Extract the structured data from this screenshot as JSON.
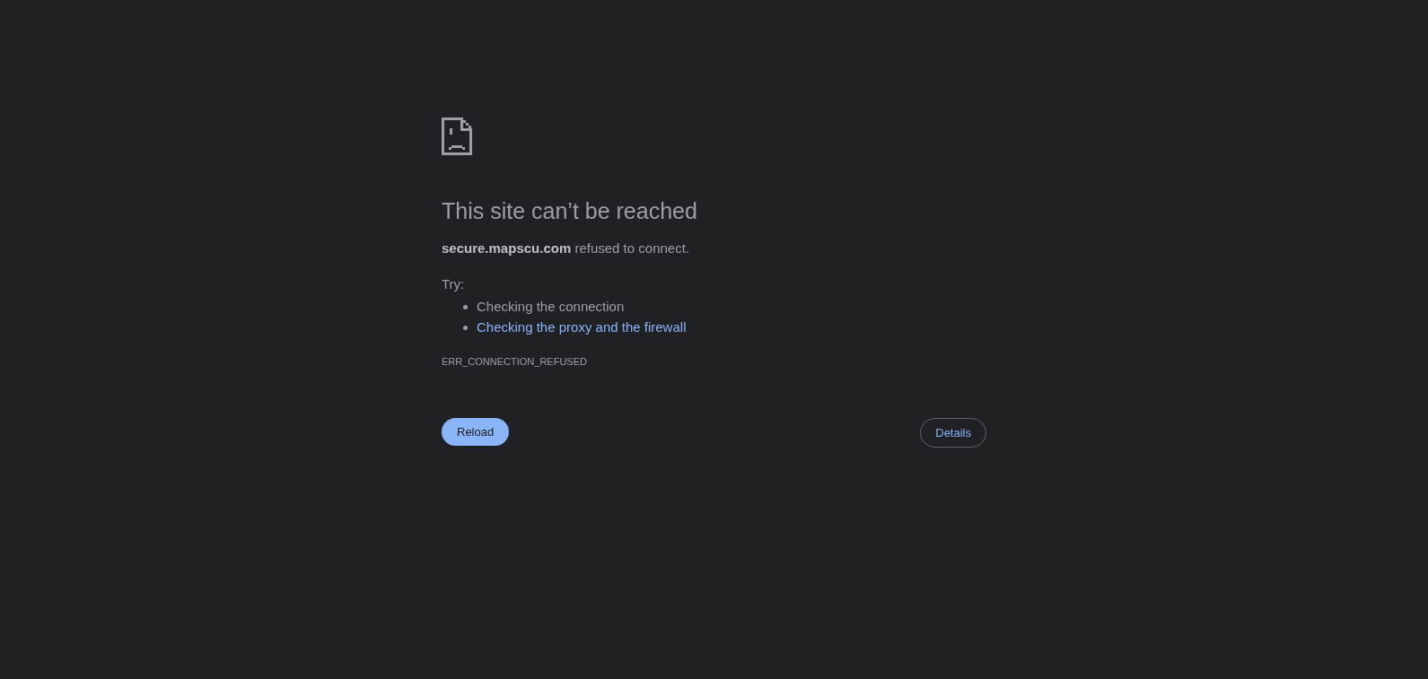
{
  "heading": "This site can’t be reached",
  "message": "**secure.mapscu.com** refused to connect.",
  "suggestions": {
    "label": "Try:",
    "items": [
      {
        "text": "Checking the connection",
        "kind": "text"
      },
      {
        "text": "Checking the proxy and the firewall",
        "kind": "link"
      }
    ]
  },
  "error_code": "ERR_CONNECTION_REFUSED",
  "buttons": [
    {
      "label": "Reload",
      "kind": "primary"
    },
    {
      "label": "Details",
      "kind": "outline"
    }
  ]
}
